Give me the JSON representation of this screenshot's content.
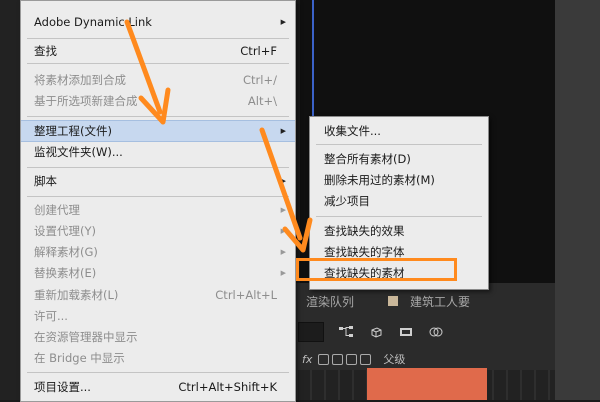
{
  "main_menu": {
    "items": [
      {
        "label": "Adobe Dynamic Link",
        "shortcut": "",
        "submenu": true,
        "disabled": false
      },
      {
        "label": "查找",
        "shortcut": "Ctrl+F",
        "submenu": false,
        "disabled": false
      },
      {
        "label": "将素材添加到合成",
        "shortcut": "Ctrl+/",
        "submenu": false,
        "disabled": true
      },
      {
        "label": "基于所选项新建合成",
        "shortcut": "Alt+\\",
        "submenu": false,
        "disabled": true
      },
      {
        "label": "整理工程(文件)",
        "shortcut": "",
        "submenu": true,
        "disabled": false,
        "highlighted": true
      },
      {
        "label": "监视文件夹(W)...",
        "shortcut": "",
        "submenu": false,
        "disabled": false
      },
      {
        "label": "脚本",
        "shortcut": "",
        "submenu": true,
        "disabled": false
      },
      {
        "label": "创建代理",
        "shortcut": "",
        "submenu": true,
        "disabled": true
      },
      {
        "label": "设置代理(Y)",
        "shortcut": "",
        "submenu": true,
        "disabled": true
      },
      {
        "label": "解释素材(G)",
        "shortcut": "",
        "submenu": true,
        "disabled": true
      },
      {
        "label": "替换素材(E)",
        "shortcut": "",
        "submenu": true,
        "disabled": true
      },
      {
        "label": "重新加载素材(L)",
        "shortcut": "Ctrl+Alt+L",
        "submenu": false,
        "disabled": true
      },
      {
        "label": "许可...",
        "shortcut": "",
        "submenu": false,
        "disabled": true
      },
      {
        "label": "在资源管理器中显示",
        "shortcut": "",
        "submenu": false,
        "disabled": true
      },
      {
        "label": "在 Bridge 中显示",
        "shortcut": "",
        "submenu": false,
        "disabled": true
      },
      {
        "label": "项目设置...",
        "shortcut": "Ctrl+Alt+Shift+K",
        "submenu": false,
        "disabled": false
      }
    ]
  },
  "submenu": {
    "items": [
      {
        "label": "收集文件..."
      },
      {
        "label": "整合所有素材(D)"
      },
      {
        "label": "删除未用过的素材(M)"
      },
      {
        "label": "减少项目"
      },
      {
        "label": "查找缺失的效果"
      },
      {
        "label": "查找缺失的字体"
      },
      {
        "label": "查找缺失的素材",
        "highlighted": true
      }
    ]
  },
  "panel": {
    "tabs": [
      "渲染队列",
      "建筑工人要"
    ],
    "column_header": "父级",
    "fx_label": "fx"
  },
  "icons": {
    "submenu_arrow": "triangle-right-icon",
    "toolbar": [
      "flowchart-icon",
      "render-icon",
      "motion-blur-icon",
      "graph-editor-icon"
    ]
  },
  "colors": {
    "menu_bg": "#ececec",
    "menu_highlight": "#c7d8ef",
    "annotation_orange": "#ff8a1e",
    "panel_bg": "#2b2b2b",
    "accent_block": "#e06a4b"
  }
}
